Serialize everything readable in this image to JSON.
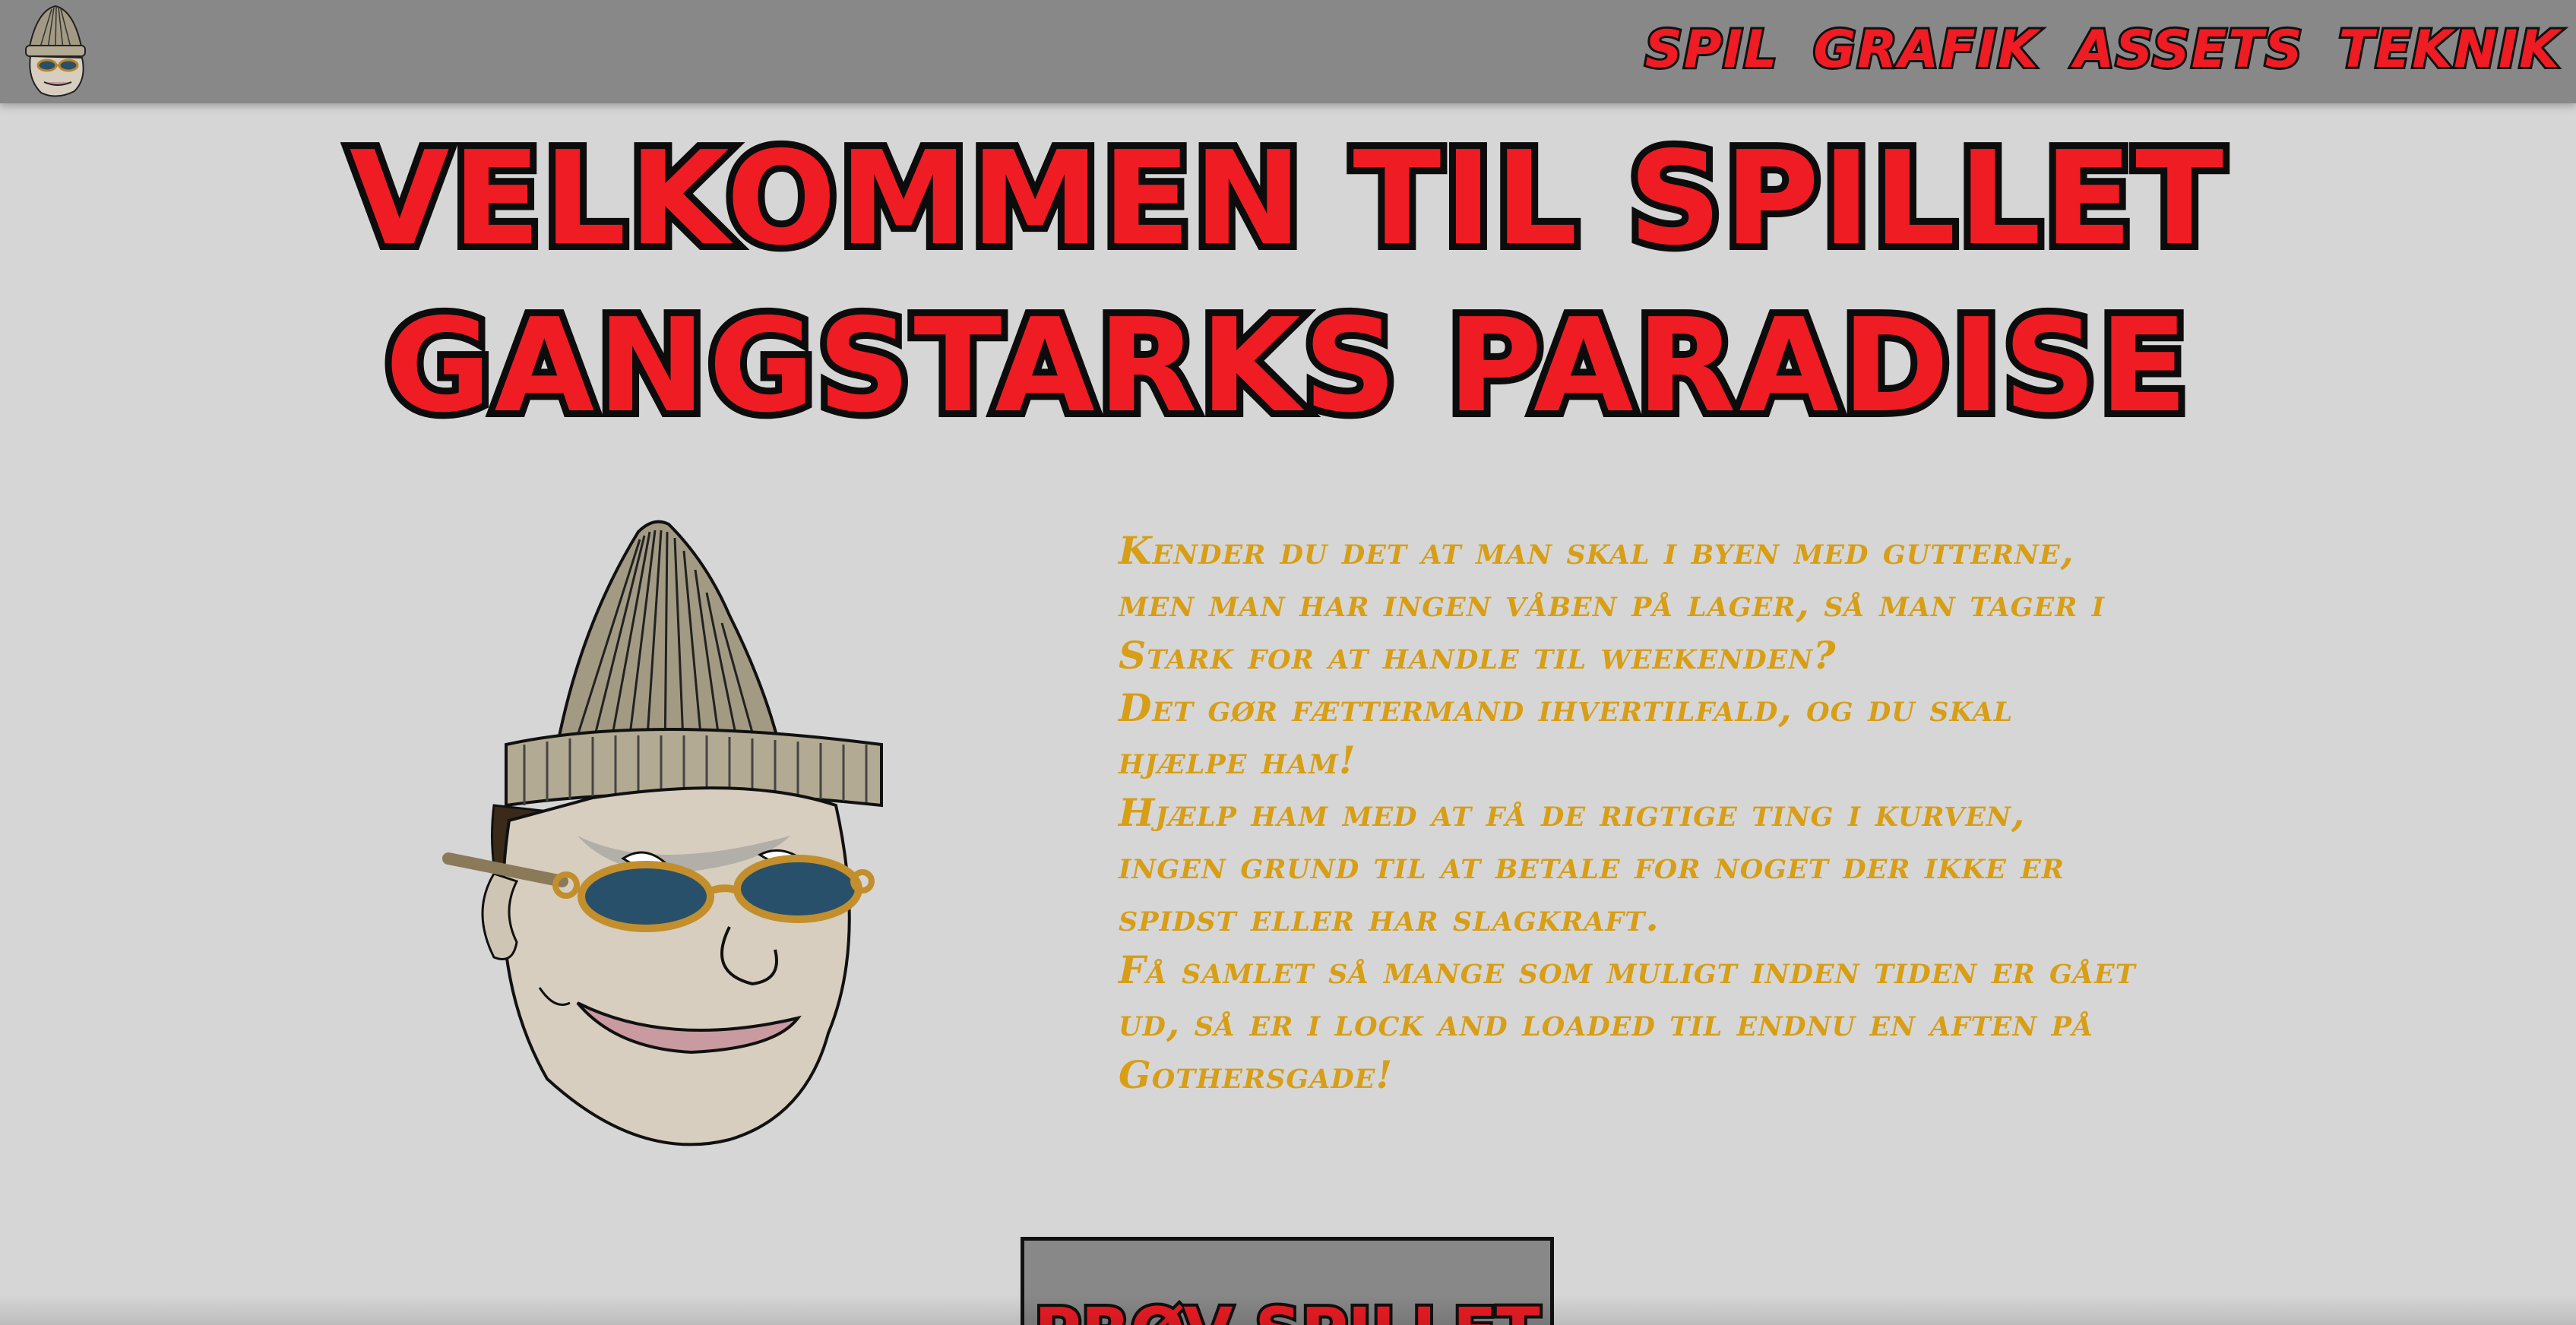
{
  "nav": {
    "items": [
      "SPIL",
      "GRAFIK",
      "ASSETS",
      "TEKNIK"
    ]
  },
  "hero": {
    "title_line1": "VELKOMMEN TIL SPILLET",
    "title_line2": "GANGSTARKS PARADISE"
  },
  "intro": {
    "lines": [
      "Kender du det at man skal i byen med gutterne, men man har ingen våben på lager, så man tager i Stark for at handle til weekenden?",
      "Det gør fættermand ihvertilfald, og du skal hjælpe ham!",
      "Hjælp ham med at få de rigtige ting i kurven, ingen grund til at betale for noget der ikke er spidst eller har slagkraft.",
      "Få samlet så mange som muligt inden tiden er gået ud, så er i lock and loaded til endnu en aften på Gothersgade!"
    ]
  },
  "cta": {
    "label": "PRØV SPILLET"
  },
  "icons": {
    "logo": "gangster-head-icon",
    "hero": "gangster-head-illustration"
  },
  "colors": {
    "accent_red": "#ef1c24",
    "text_gold": "#d79e16",
    "nav_bg": "#888888",
    "page_bg": "#d6d6d6"
  }
}
